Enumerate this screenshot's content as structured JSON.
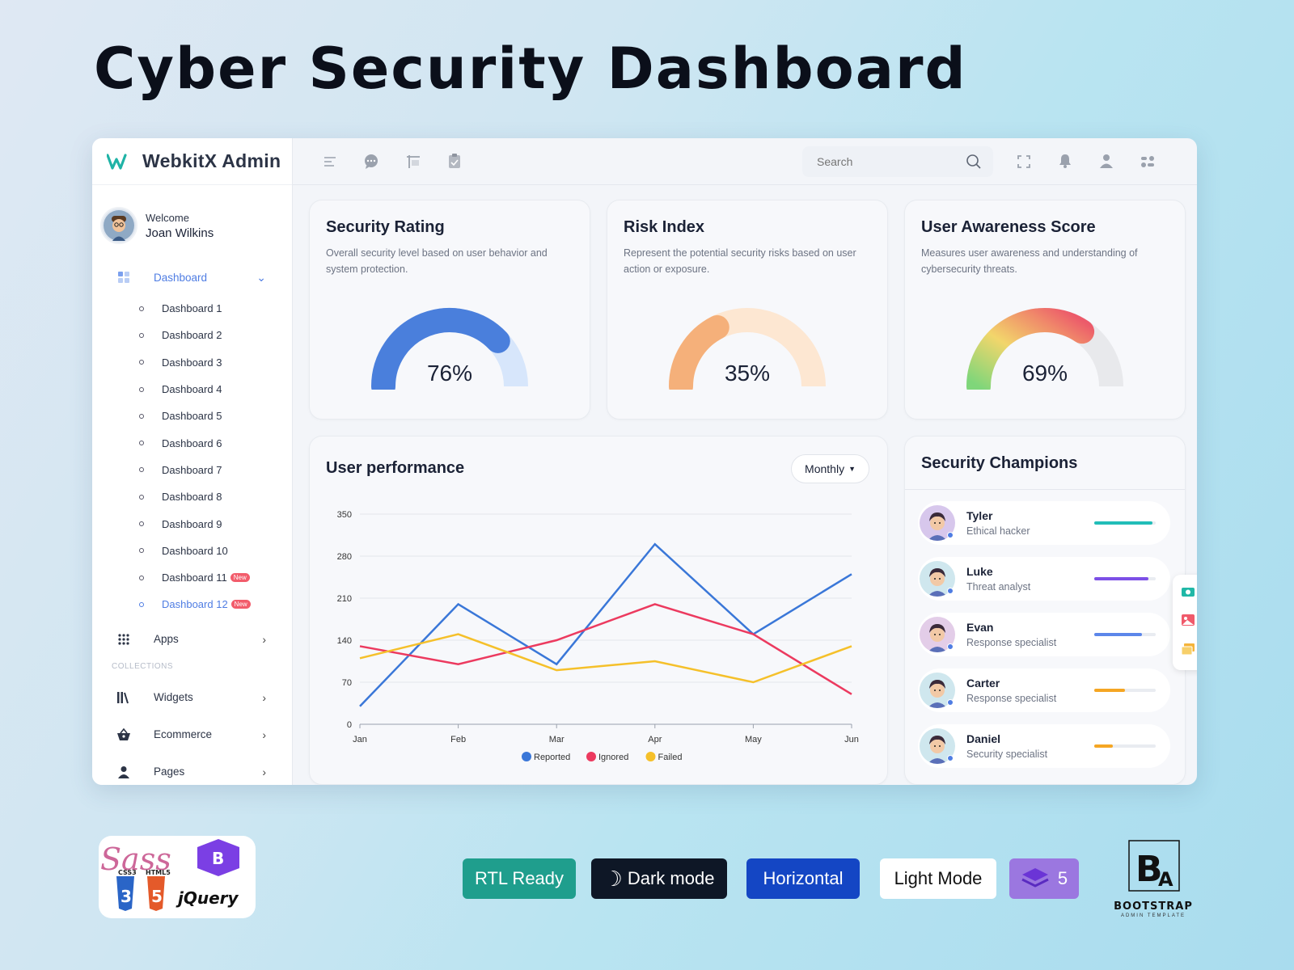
{
  "hero": {
    "title": "Cyber Security Dashboard"
  },
  "brand": {
    "name": "WebkitX Admin"
  },
  "user": {
    "welcome": "Welcome",
    "name": "Joan Wilkins"
  },
  "sidebar": {
    "dashboard_label": "Dashboard",
    "sub_items": [
      {
        "label": "Dashboard 1"
      },
      {
        "label": "Dashboard 2"
      },
      {
        "label": "Dashboard 3"
      },
      {
        "label": "Dashboard 4"
      },
      {
        "label": "Dashboard 5"
      },
      {
        "label": "Dashboard 6"
      },
      {
        "label": "Dashboard 7"
      },
      {
        "label": "Dashboard 8"
      },
      {
        "label": "Dashboard 9"
      },
      {
        "label": "Dashboard 10"
      },
      {
        "label": "Dashboard 11",
        "badge": "New"
      },
      {
        "label": "Dashboard 12",
        "badge": "New"
      }
    ],
    "apps_label": "Apps",
    "collections_caption": "COLLECTIONS",
    "widgets_label": "Widgets",
    "ecommerce_label": "Ecommerce",
    "pages_label": "Pages"
  },
  "search": {
    "placeholder": "Search"
  },
  "cards": {
    "security_rating": {
      "title": "Security Rating",
      "desc": "Overall security level based on user behavior and system protection.",
      "value": "76%",
      "fraction": 0.76,
      "color": "#4a7fdc",
      "track": "#d7e6fb"
    },
    "risk_index": {
      "title": "Risk Index",
      "desc": "Represent the potential security risks based on user action or exposure.",
      "value": "35%",
      "fraction": 0.35,
      "color": "#f5b07a",
      "track": "#fde7d2"
    },
    "awareness": {
      "title": "User Awareness Score",
      "desc": "Measures user awareness and understanding of cybersecurity threats.",
      "value": "69%",
      "fraction": 0.69,
      "track": "#e8e9ec"
    }
  },
  "performance": {
    "title": "User performance",
    "filter": "Monthly",
    "chart_data": {
      "type": "line",
      "categories": [
        "Jan",
        "Feb",
        "Mar",
        "Apr",
        "May",
        "Jun"
      ],
      "ylim": [
        0,
        350
      ],
      "yticks": [
        0,
        70,
        140,
        210,
        280,
        350
      ],
      "series": [
        {
          "name": "Reported",
          "color": "#3a77d8",
          "values": [
            30,
            200,
            100,
            300,
            150,
            250
          ]
        },
        {
          "name": "Ignored",
          "color": "#ec3a5f",
          "values": [
            130,
            100,
            140,
            200,
            150,
            50
          ]
        },
        {
          "name": "Failed",
          "color": "#f5c02a",
          "values": [
            110,
            150,
            90,
            105,
            70,
            130
          ]
        }
      ],
      "legend": "bottom",
      "grid": true
    }
  },
  "champions": {
    "title": "Security Champions",
    "items": [
      {
        "name": "Tyler",
        "role": "Ethical hacker",
        "progress": 0.95,
        "color": "#22bdb8",
        "avatar": "#d7c7ec"
      },
      {
        "name": "Luke",
        "role": "Threat analyst",
        "progress": 0.88,
        "color": "#7c4fe6",
        "avatar": "#cfe7ee"
      },
      {
        "name": "Evan",
        "role": "Response specialist",
        "progress": 0.78,
        "color": "#5c86ea",
        "avatar": "#e3cde8"
      },
      {
        "name": "Carter",
        "role": "Response specialist",
        "progress": 0.5,
        "color": "#f5a623",
        "avatar": "#cfe7ee"
      },
      {
        "name": "Daniel",
        "role": "Security specialist",
        "progress": 0.3,
        "color": "#f5a623",
        "avatar": "#cfe7ee"
      }
    ]
  },
  "badges": {
    "rtl": "RTL Ready",
    "dark": "Dark mode",
    "horizontal": "Horizontal",
    "light": "Light Mode",
    "bs_version": "5",
    "bootstrap_title": "BOOTSTRAP",
    "bootstrap_sub": "ADMIN TEMPLATE",
    "tech": [
      "Sass",
      "CSS3",
      "HTML5",
      "jQuery"
    ]
  }
}
